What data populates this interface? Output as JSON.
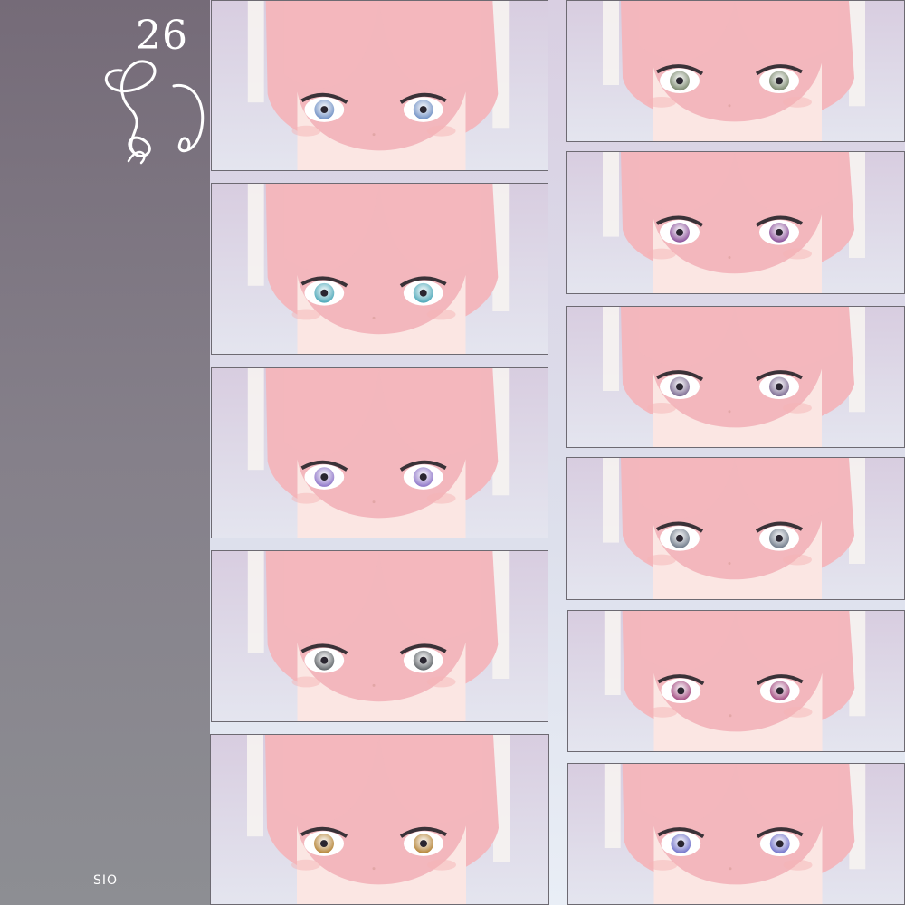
{
  "header": {
    "number": "26"
  },
  "footer": {
    "credit": "SIO"
  },
  "colors": {
    "sidebar_top": "#756b78",
    "sidebar_bottom": "#8d8e93",
    "hair": "#f3b7bd",
    "skin": "#fbe6e3",
    "ribbon": "#f6f3f1"
  },
  "eye_variants": [
    {
      "icon": "blue-eye-icon",
      "color": "#6e8fc4"
    },
    {
      "icon": "teal-eye-icon",
      "color": "#4aa7b8"
    },
    {
      "icon": "violet-eye-icon",
      "color": "#8d74c8"
    },
    {
      "icon": "gray-eye-icon",
      "color": "#5f6468"
    },
    {
      "icon": "amber-eye-icon",
      "color": "#b48233"
    },
    {
      "icon": "olive-eye-icon",
      "color": "#77856a"
    },
    {
      "icon": "purple-eye-icon",
      "color": "#8a4f9a"
    },
    {
      "icon": "lavender-eye-icon",
      "color": "#7a6890"
    },
    {
      "icon": "slate-eye-icon",
      "color": "#6c7887"
    },
    {
      "icon": "magenta-eye-icon",
      "color": "#a2497f"
    },
    {
      "icon": "periwinkle-eye-icon",
      "color": "#6e6fc9"
    }
  ]
}
